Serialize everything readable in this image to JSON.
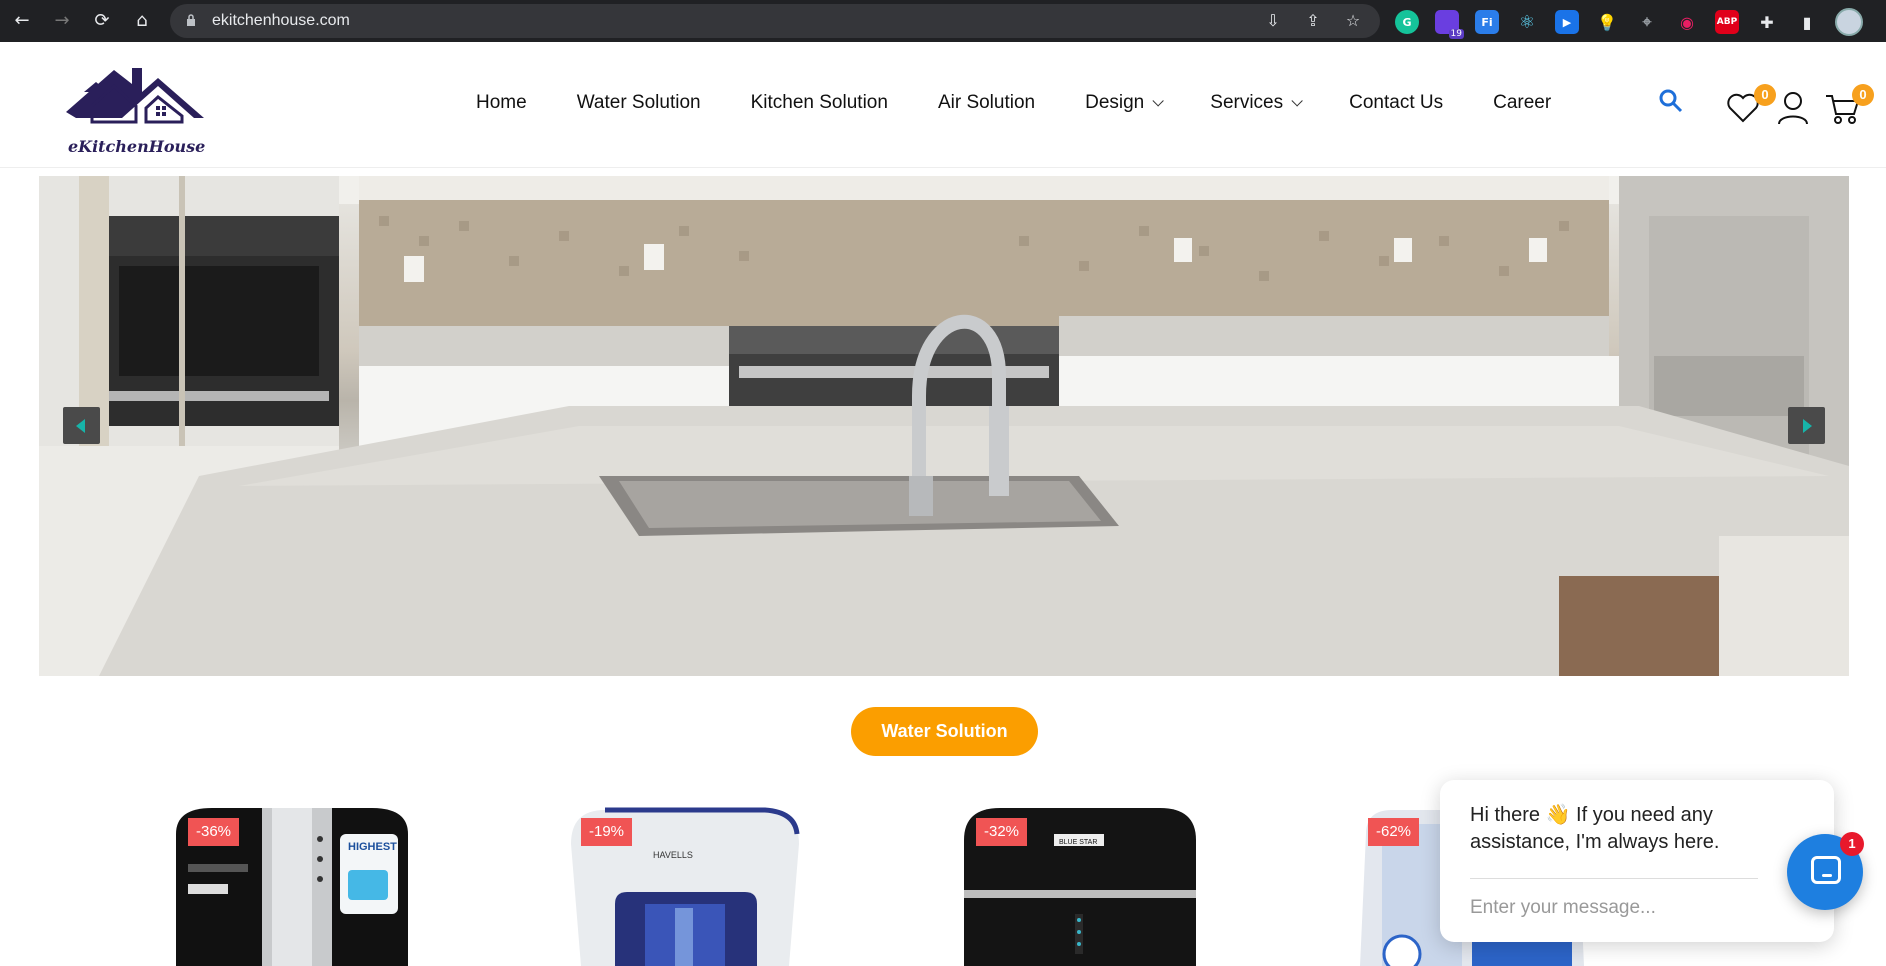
{
  "browser": {
    "url": "ekitchenhouse.com",
    "extension_badge": "19",
    "abp_label": "ABP"
  },
  "site": {
    "logo_text": "eKitchenHouse",
    "nav": [
      {
        "label": "Home"
      },
      {
        "label": "Water Solution"
      },
      {
        "label": "Kitchen Solution"
      },
      {
        "label": "Air Solution"
      },
      {
        "label": "Design",
        "has_dropdown": true
      },
      {
        "label": "Services",
        "has_dropdown": true
      },
      {
        "label": "Contact Us"
      },
      {
        "label": "Career"
      }
    ],
    "wishlist_count": "0",
    "cart_count": "0",
    "accent_color": "#fb9e00",
    "search_icon_color": "#1e6fd9"
  },
  "section": {
    "title": "Water Solution"
  },
  "products": [
    {
      "discount": "-36%",
      "icon": "water-purifier-black-silver"
    },
    {
      "discount": "-19%",
      "icon": "water-purifier-havells-blue"
    },
    {
      "discount": "-32%",
      "icon": "water-purifier-bluestar-black"
    },
    {
      "discount": "-62%",
      "icon": "water-purifier-white-blue"
    }
  ],
  "products_extra": {
    "product_1_label": "HIGHEST",
    "product_2_brand": "HAVELLS",
    "product_3_brand": "BLUE STAR"
  },
  "chat": {
    "greeting": "Hi there 👋 If you need any assistance, I'm always here.",
    "placeholder": "Enter your message...",
    "unread": "1"
  }
}
